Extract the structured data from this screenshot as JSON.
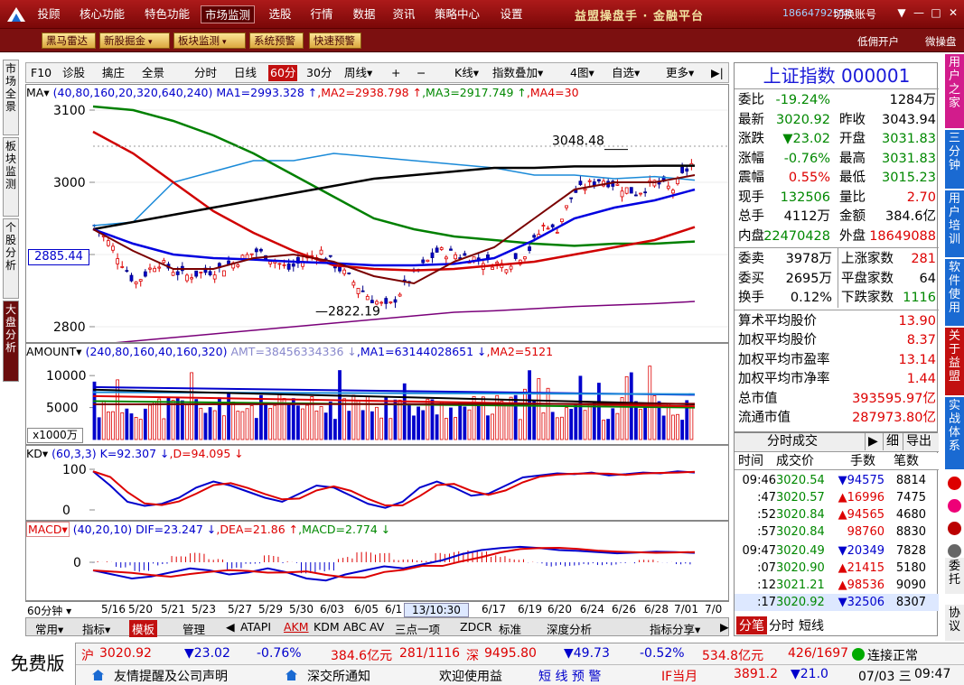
{
  "app": {
    "brand": "益盟操盘手 · 金融平台",
    "phone": "18664792558",
    "switch_account": "切换账号",
    "win_buttons": [
      "▼",
      "—",
      "□",
      "✕"
    ]
  },
  "menu": [
    "投顾",
    "核心功能",
    "特色功能",
    "市场监测",
    "选股",
    "行情",
    "数据",
    "资讯",
    "策略中心",
    "设置"
  ],
  "menu_active": "市场监测",
  "toolbar2": {
    "buttons": [
      "黑马雷达",
      "新股掘金",
      "板块监测",
      "系统预警",
      "快速预警"
    ],
    "right": [
      "低佣开户",
      "微操盘"
    ]
  },
  "left_tabs": [
    "市场全景",
    "板块监测",
    "个股分析",
    "大盘分析"
  ],
  "chart_toolbar": {
    "items": [
      "F10",
      "诊股",
      "擒庄",
      "全景",
      "分时",
      "日线",
      "60分",
      "30分",
      "周线▾",
      "+",
      "−",
      "K线▾",
      "指数叠加▾",
      "4图▾",
      "自选▾",
      "更多▾",
      "▶|"
    ],
    "active": "60分"
  },
  "main_panel": {
    "ma_label": "MA▾",
    "params": "(40,80,160,20,320,640,240)",
    "ma1": "MA1=2993.328 ↑",
    "ma2": ",MA2=2938.798 ↑",
    "ma3": ",MA3=2917.749 ↑",
    "ma4": ",MA4=30",
    "y_ticks": [
      "3100",
      "3000",
      "2900",
      "2800"
    ],
    "price_box": "2885.44",
    "high_label": "3048.48",
    "low_label": "—2822.19"
  },
  "amount_panel": {
    "label": "AMOUNT▾",
    "params": "(240,80,160,40,160,320)",
    "amt": "AMT=38456334336 ↓",
    "ma1": ",MA1=63144028651 ↓",
    "ma2": ",MA2=5121",
    "y_ticks": [
      "10000",
      "5000"
    ],
    "unit": "x1000万"
  },
  "kd_panel": {
    "label": "KD▾",
    "params": "(60,3,3)",
    "k": "K=92.307 ↓",
    "d": ",D=94.095 ↓",
    "y_ticks": [
      "100",
      "0"
    ]
  },
  "macd_panel": {
    "label": "MACD▾",
    "params": "(40,20,10)",
    "dif": "DIF=23.247 ↓",
    "dea": ",DEA=21.86 ↑",
    "macd": ",MACD=2.774 ↓",
    "y_ticks": [
      "0"
    ]
  },
  "date_axis": {
    "period": "60分钟 ▾",
    "labels": [
      "5/16",
      "5/20",
      "5/21",
      "5/23",
      "5/27",
      "5/29",
      "5/30",
      "6/03",
      "6/05",
      "6/1",
      "13/10:30",
      "6/17",
      "6/19",
      "6/20",
      "6/24",
      "6/26",
      "6/28",
      "7/01",
      "7/0"
    ]
  },
  "bottom_tabs": [
    "常用▾",
    "指标▾",
    "模板",
    "管理",
    "◀",
    "ATAPI",
    "AKM",
    "KDM",
    "ABC",
    "AV",
    "三点一项",
    "ZDCR",
    "标准",
    "深度分析",
    "指标分享▾",
    "▶"
  ],
  "bottom_active": "模板",
  "quote": {
    "title": "上证指数 000001",
    "rows": [
      {
        "l": "委比",
        "v": "-19.24%",
        "vc": "green",
        "r": "",
        "rv": "1284万",
        "rc": "blk"
      },
      {
        "l": "最新",
        "v": "3020.92",
        "vc": "green",
        "r": "昨收",
        "rv": "3043.94",
        "rc": "blk"
      },
      {
        "l": "涨跌",
        "v": "▼23.02",
        "vc": "green",
        "r": "开盘",
        "rv": "3031.83",
        "rc": "green"
      },
      {
        "l": "涨幅",
        "v": "-0.76%",
        "vc": "green",
        "r": "最高",
        "rv": "3031.83",
        "rc": "green"
      },
      {
        "l": "震幅",
        "v": "0.55%",
        "vc": "red",
        "r": "最低",
        "rv": "3015.23",
        "rc": "green"
      },
      {
        "l": "现手",
        "v": "132506",
        "vc": "green",
        "r": "量比",
        "rv": "2.70",
        "rc": "red"
      },
      {
        "l": "总手",
        "v": "4112万",
        "vc": "blk",
        "r": "金额",
        "rv": "384.6亿",
        "rc": "blk"
      },
      {
        "l": "内盘",
        "v": "22470428",
        "vc": "green",
        "r": "外盘",
        "rv": "18649088",
        "rc": "red"
      }
    ],
    "rows2": [
      {
        "l": "委卖",
        "v": "3978万",
        "vc": "blk",
        "r": "上涨家数",
        "rv": "281",
        "rc": "red"
      },
      {
        "l": "委买",
        "v": "2695万",
        "vc": "blk",
        "r": "平盘家数",
        "rv": "64",
        "rc": "blk"
      },
      {
        "l": "换手",
        "v": "0.12%",
        "vc": "blk",
        "r": "下跌家数",
        "rv": "1116",
        "rc": "green"
      }
    ],
    "rows3": [
      {
        "l": "算术平均股价",
        "v": "13.90",
        "vc": "red"
      },
      {
        "l": "加权平均股价",
        "v": "8.37",
        "vc": "red"
      },
      {
        "l": "加权平均市盈率",
        "v": "13.14",
        "vc": "red"
      },
      {
        "l": "加权平均市净率",
        "v": "1.44",
        "vc": "red"
      },
      {
        "l": "总市值",
        "v": "393595.97亿",
        "vc": "red"
      },
      {
        "l": "流通市值",
        "v": "287973.80亿",
        "vc": "red"
      }
    ]
  },
  "trades": {
    "title": "分时成交",
    "btns": [
      "▶",
      "细",
      "导出"
    ],
    "headers": [
      "时间",
      "成交价",
      "手数",
      "笔数"
    ],
    "rows": [
      [
        "09:46",
        "3020.54",
        "▼94575",
        "8814"
      ],
      [
        ":47",
        "3020.57",
        "▲16996",
        "7475"
      ],
      [
        ":52",
        "3020.84",
        "▲94565",
        "4680"
      ],
      [
        ":57",
        "3020.84",
        "98760",
        "8830"
      ],
      [
        "09:47",
        "3020.49",
        "▼20349",
        "7828"
      ],
      [
        ":07",
        "3020.90",
        "▲21415",
        "5180"
      ],
      [
        ":12",
        "3021.21",
        "▲98536",
        "9090"
      ],
      [
        ":17",
        "3020.92",
        "▼32506",
        "8307"
      ]
    ],
    "tabs": [
      "分笔",
      "分时",
      "短线"
    ],
    "active_tab": "分笔"
  },
  "right_strip": [
    {
      "t": "用户之家",
      "c": "#d21c8c"
    },
    {
      "t": "三分钟",
      "c": "#1a6ad2"
    },
    {
      "t": "用户培训",
      "c": "#1a6ad2"
    },
    {
      "t": "软件使用",
      "c": "#1a6ad2"
    },
    {
      "t": "关于益盟",
      "c": "#c21010"
    },
    {
      "t": "实战体系",
      "c": "#1a6ad2"
    }
  ],
  "right_strip_icons": [
    "委托",
    "协议"
  ],
  "status": {
    "free": "免费版",
    "sh_label": "沪",
    "sh_price": "3020.92",
    "sh_chg": "▼23.02",
    "sh_pct": "-0.76%",
    "sh_amt": "384.6亿元",
    "sh_ud": "281/1116",
    "sz_label": "深",
    "sz_price": "9495.80",
    "sz_chg": "▼49.73",
    "sz_pct": "-0.52%",
    "sz_amt": "534.8亿元",
    "sz_ud": "426/1697",
    "conn": "连接正常",
    "notice1": "友情提醒及公司声明",
    "notice2": "深交所通知",
    "welcome": "欢迎使用益",
    "alert": "短 线 预 警",
    "if_label": "IF当月",
    "if_price": "3891.2",
    "if_chg": "▼21.0",
    "date": "07/03 三",
    "time": "09:47"
  },
  "colors": {
    "up": "#d00000",
    "down": "#008000",
    "accent": "#c21010"
  }
}
